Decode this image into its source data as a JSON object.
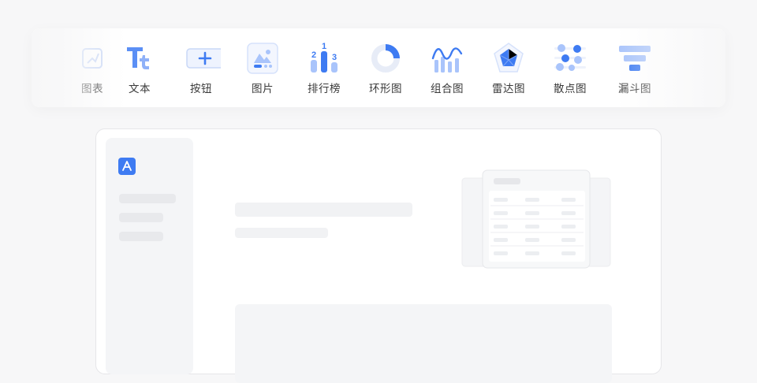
{
  "toolbar": {
    "items": [
      {
        "label": "图表",
        "icon": "chart-icon"
      },
      {
        "label": "文本",
        "icon": "text-icon"
      },
      {
        "label": "按钮",
        "icon": "button-icon"
      },
      {
        "label": "图片",
        "icon": "image-icon"
      },
      {
        "label": "排行榜",
        "icon": "ranking-icon"
      },
      {
        "label": "环形图",
        "icon": "donut-chart-icon"
      },
      {
        "label": "组合图",
        "icon": "combo-chart-icon"
      },
      {
        "label": "雷达图",
        "icon": "radar-chart-icon"
      },
      {
        "label": "散点图",
        "icon": "scatter-chart-icon"
      },
      {
        "label": "漏斗图",
        "icon": "funnel-chart-icon"
      }
    ],
    "ranking_numbers": [
      "1",
      "2",
      "3"
    ]
  },
  "preview": {
    "logo_icon": "app-store-icon"
  },
  "colors": {
    "accent": "#3e7bf2",
    "accent_light": "#a9c4fb",
    "skeleton": "#e8e9ec",
    "background": "#f7f7f8"
  }
}
